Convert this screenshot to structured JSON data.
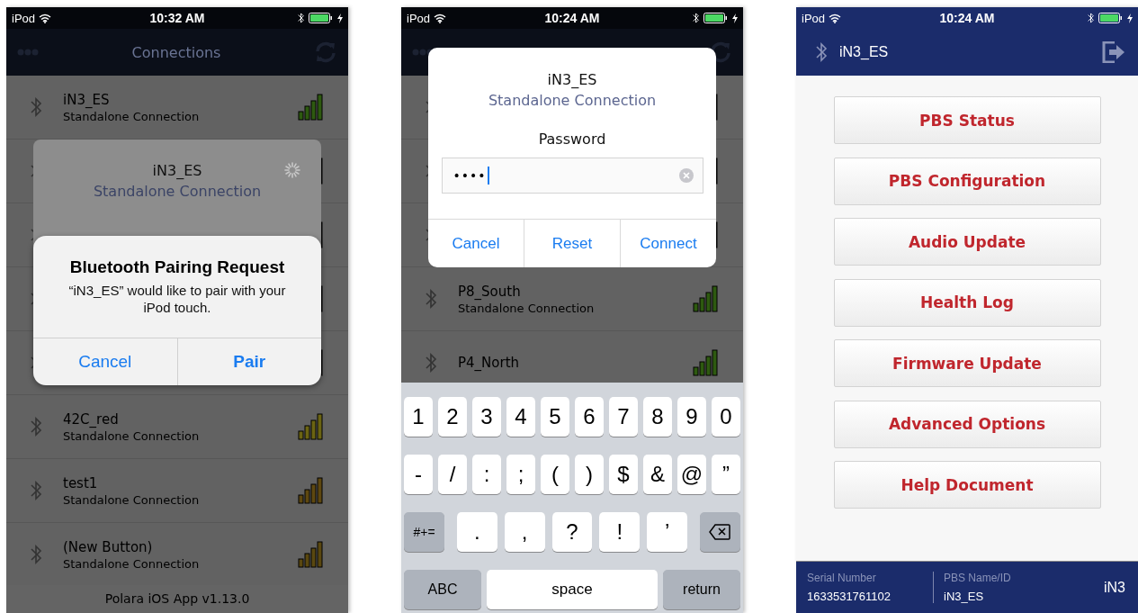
{
  "screens": [
    {
      "kind": "pairing",
      "status_bar": {
        "carrier": "iPod",
        "time": "10:32 AM"
      },
      "nav": {
        "title": "Connections"
      },
      "devices": [
        {
          "name": "iN3_ES",
          "subtitle": "Standalone Connection",
          "color": "#2e5a10"
        },
        {
          "kind": "covered"
        },
        {
          "kind": "covered"
        },
        {
          "kind": "covered"
        },
        {
          "kind": "covered"
        },
        {
          "name": "42C_red",
          "subtitle": "Standalone Connection",
          "color": "#6b6412"
        },
        {
          "name": "test1",
          "subtitle": "Standalone Connection",
          "color": "#5e4810"
        },
        {
          "name": "(New Button)",
          "subtitle": "Standalone Connection",
          "color": "#5a4810"
        }
      ],
      "footer": "Polara iOS App v1.13.0",
      "connect_dialog": {
        "title": "iN3_ES",
        "subtitle": "Standalone Connection",
        "busy": true
      },
      "alert": {
        "title": "Bluetooth Pairing Request",
        "message": "“iN3_ES” would like to pair with your iPod touch.",
        "buttons": [
          {
            "label": "Cancel",
            "bold": false
          },
          {
            "label": "Pair",
            "bold": true
          }
        ]
      }
    },
    {
      "kind": "password",
      "status_bar": {
        "carrier": "iPod",
        "time": "10:24 AM"
      },
      "devices": [
        {
          "kind": "covered"
        },
        {
          "kind": "covered"
        },
        {
          "kind": "covered"
        },
        {
          "name": "P8_South",
          "subtitle": "Standalone Connection",
          "color": "#2e5a10"
        },
        {
          "name": "P4_North",
          "color": "#2e5a10"
        }
      ],
      "connect_dialog": {
        "title": "iN3_ES",
        "subtitle": "Standalone Connection",
        "label": "Password",
        "field": {
          "value": "••••"
        },
        "buttons": [
          "Cancel",
          "Reset",
          "Connect"
        ]
      },
      "keyboard": {
        "number_row": [
          {
            "kind": "char",
            "label": "1"
          },
          {
            "kind": "char",
            "label": "2"
          },
          {
            "kind": "char",
            "label": "3"
          },
          {
            "kind": "char",
            "label": "4"
          },
          {
            "kind": "char",
            "label": "5"
          },
          {
            "kind": "char",
            "label": "6"
          },
          {
            "kind": "char",
            "label": "7"
          },
          {
            "kind": "char",
            "label": "8"
          },
          {
            "kind": "char",
            "label": "9"
          },
          {
            "kind": "char",
            "label": "0"
          }
        ],
        "symbol_row": [
          {
            "kind": "char",
            "label": "-"
          },
          {
            "kind": "char",
            "label": "/"
          },
          {
            "kind": "char",
            "label": ":"
          },
          {
            "kind": "char",
            "label": ";"
          },
          {
            "kind": "char",
            "label": "("
          },
          {
            "kind": "char",
            "label": ")"
          },
          {
            "kind": "char",
            "label": "$"
          },
          {
            "kind": "char",
            "label": "&"
          },
          {
            "kind": "char",
            "label": "@"
          },
          {
            "kind": "char",
            "label": "”"
          }
        ],
        "punctuation_row": [
          {
            "kind": "function",
            "label": "#+="
          },
          {
            "kind": "char",
            "label": "."
          },
          {
            "kind": "char",
            "label": ","
          },
          {
            "kind": "char",
            "label": "?"
          },
          {
            "kind": "char",
            "label": "!"
          },
          {
            "kind": "char",
            "label": "’"
          },
          {
            "kind": "delete"
          }
        ],
        "bottom_row": [
          {
            "kind": "function",
            "label": "ABC"
          },
          {
            "kind": "space",
            "label": "space"
          },
          {
            "kind": "function",
            "label": "return"
          }
        ]
      }
    },
    {
      "kind": "menu",
      "status_bar": {
        "carrier": "iPod",
        "time": "10:24 AM"
      },
      "header": {
        "title": "iN3_ES"
      },
      "menu": [
        "PBS Status",
        "PBS Configuration",
        "Audio Update",
        "Health Log",
        "Firmware Update",
        "Advanced Options",
        "Help Document"
      ],
      "footer": {
        "fields": [
          {
            "label": "Serial Number",
            "value": "1633531761102"
          },
          {
            "label": "PBS Name/ID",
            "value": "iN3_ES"
          }
        ],
        "brand": "iN3"
      }
    }
  ]
}
